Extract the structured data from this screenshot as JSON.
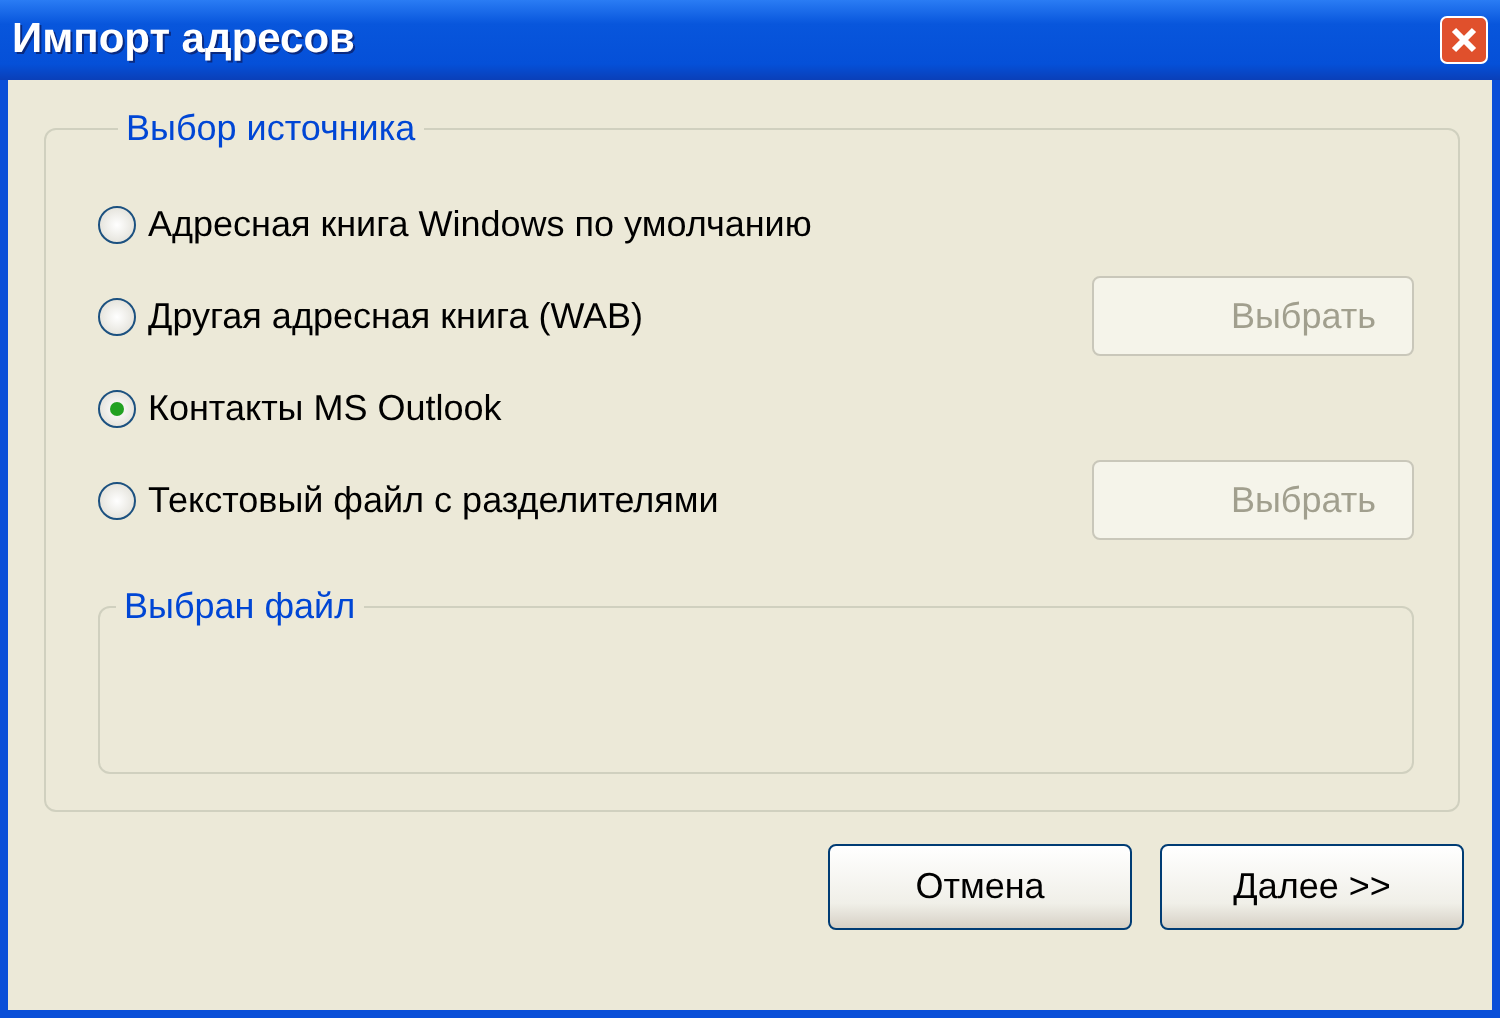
{
  "window": {
    "title": "Импорт адресов"
  },
  "source_group": {
    "label": "Выбор источника",
    "options": [
      {
        "label": "Адресная книга Windows по умолчанию",
        "selected": false
      },
      {
        "label": "Другая адресная книга (WAB)",
        "selected": false,
        "button": {
          "label": "Выбрать",
          "disabled": true
        }
      },
      {
        "label": "Контакты MS Outlook",
        "selected": true
      },
      {
        "label": "Текстовый файл с разделителями",
        "selected": false,
        "button": {
          "label": "Выбрать",
          "disabled": true
        }
      }
    ]
  },
  "file_group": {
    "label": "Выбран файл"
  },
  "buttons": [
    {
      "label": "Отмена"
    },
    {
      "label": "Далее >>"
    }
  ]
}
